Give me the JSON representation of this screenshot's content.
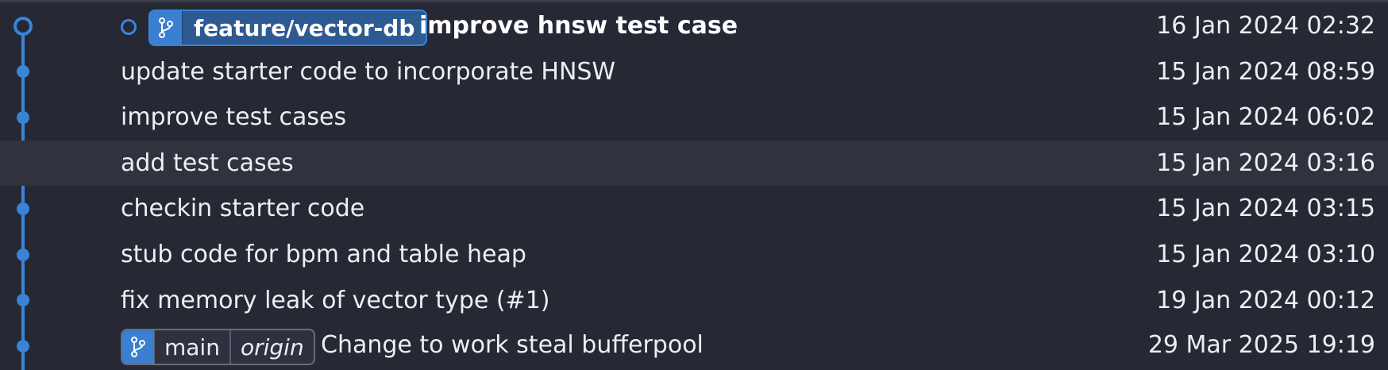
{
  "colors": {
    "accent": "#3a84d8",
    "background": "#262834",
    "selected_row": "#30323e"
  },
  "head": {
    "branch_label": "feature/vector-db",
    "branch_icon": "git-branch-icon",
    "message": "improve hnsw test case",
    "date": "16 Jan 2024 02:32"
  },
  "commits": [
    {
      "message": "update starter code to incorporate HNSW",
      "date": "15 Jan 2024 08:59"
    },
    {
      "message": "improve test cases",
      "date": "15 Jan 2024 06:02"
    },
    {
      "message": "add test cases",
      "date": "15 Jan 2024 03:16"
    },
    {
      "message": "checkin starter code",
      "date": "15 Jan 2024 03:15"
    },
    {
      "message": "stub code for bpm and table heap",
      "date": "15 Jan 2024 03:10"
    },
    {
      "message": "fix memory leak of vector type (#1)",
      "date": "19 Jan 2024 00:12"
    }
  ],
  "main": {
    "branch_label": "main",
    "remote_label": "origin",
    "branch_icon": "git-branch-icon",
    "message": "Change to work steal bufferpool",
    "date": "29 Mar 2025 19:19"
  }
}
